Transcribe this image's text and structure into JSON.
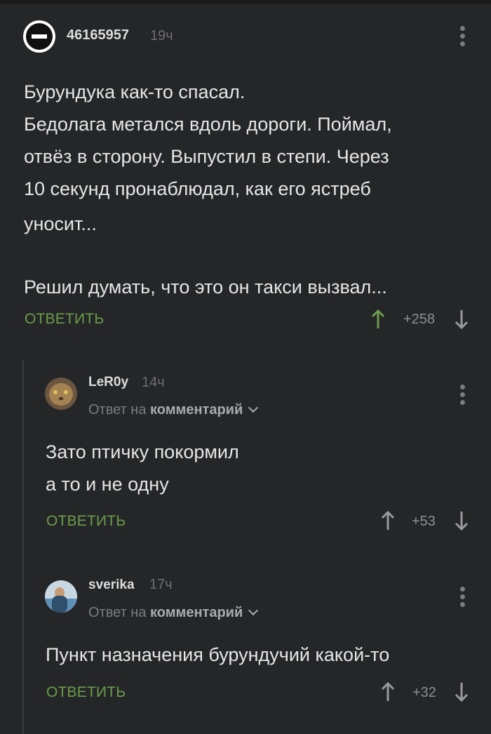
{
  "comments": [
    {
      "username": "46165957",
      "time": "19ч",
      "text_lines": [
        "Бурундука как-то спасал.",
        "Бедолага метался вдоль дороги. Поймал,",
        "отвёз в сторону. Выпустил в степи. Через",
        "10 секунд пронаблюдал, как его ястреб",
        "уносит...",
        "",
        "Решил думать, что это он такси вызвал..."
      ],
      "reply_label": "ОТВЕТИТЬ",
      "rating": "+258",
      "upvoted": true
    },
    {
      "username": "LeR0y",
      "time": "14ч",
      "reply_prefix": "Ответ на",
      "reply_target": "комментарий",
      "text_lines": [
        "Зато птичку покормил",
        "а то и не одну"
      ],
      "reply_label": "ОТВЕТИТЬ",
      "rating": "+53"
    },
    {
      "username": "sverika",
      "time": "17ч",
      "reply_prefix": "Ответ на",
      "reply_target": "комментарий",
      "text_lines": [
        "Пункт назначения бурундучий какой-то"
      ],
      "reply_label": "ОТВЕТИТЬ",
      "rating": "+32"
    }
  ],
  "colors": {
    "background": "#252628",
    "accent_green": "#6a9d4a",
    "muted": "#7b7c7f"
  }
}
